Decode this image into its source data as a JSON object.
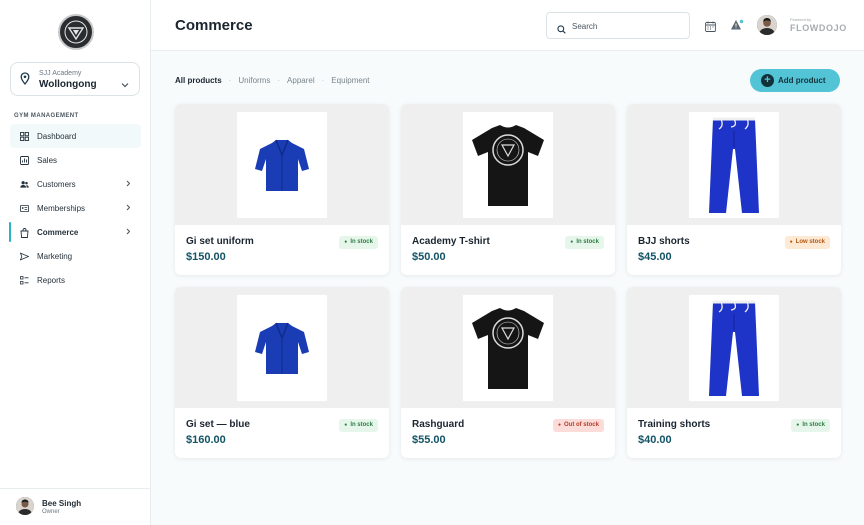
{
  "academy": {
    "small": "SJJ Academy",
    "name": "Wollongong"
  },
  "sidebar": {
    "section_title": "GYM MANAGEMENT",
    "items": [
      {
        "label": "Dashboard",
        "icon": "dashboard-icon"
      },
      {
        "label": "Sales",
        "icon": "chart-icon"
      },
      {
        "label": "Customers",
        "icon": "users-icon"
      },
      {
        "label": "Memberships",
        "icon": "card-icon"
      },
      {
        "label": "Commerce",
        "icon": "bag-icon"
      },
      {
        "label": "Marketing",
        "icon": "send-icon"
      },
      {
        "label": "Reports",
        "icon": "list-icon"
      }
    ]
  },
  "user": {
    "name": "Bee Singh",
    "role": "Owner"
  },
  "header": {
    "title": "Commerce",
    "search_placeholder": "Search",
    "powered_by": "Powered by",
    "brand": "FLOWDOJO"
  },
  "filters": [
    "All products",
    "Uniforms",
    "Apparel",
    "Equipment"
  ],
  "add_product_label": "Add product",
  "products": [
    {
      "name": "Gi set uniform",
      "price": "$150.00",
      "status": "In stock",
      "image": "gi-jacket"
    },
    {
      "name": "Academy T-shirt",
      "price": "$50.00",
      "status": "In stock",
      "image": "tshirt"
    },
    {
      "name": "BJJ shorts",
      "price": "$45.00",
      "status": "Low stock",
      "image": "pants"
    },
    {
      "name": "Gi set — blue",
      "price": "$160.00",
      "status": "In stock",
      "image": "gi-jacket"
    },
    {
      "name": "Rashguard",
      "price": "$55.00",
      "status": "Out of stock",
      "image": "tshirt"
    },
    {
      "name": "Training shorts",
      "price": "$40.00",
      "status": "In stock",
      "image": "pants"
    }
  ],
  "colors": {
    "accent": "#53c3d6",
    "price": "#135466",
    "in_stock": "#2e7d44",
    "low_stock": "#b5590f",
    "out_of_stock": "#b73c2a"
  }
}
